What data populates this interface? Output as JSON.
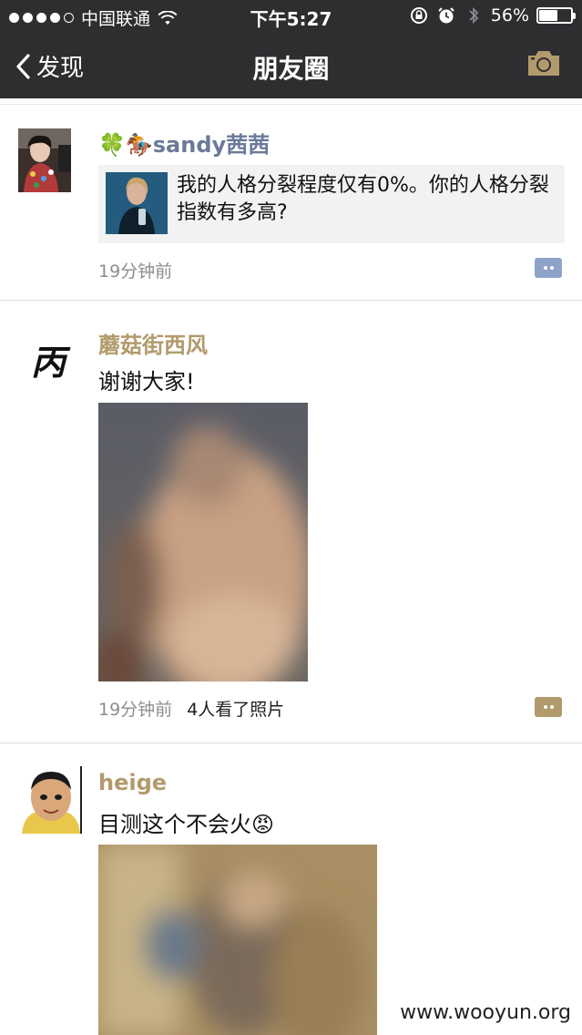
{
  "status_bar": {
    "carrier": "中国联通",
    "time": "下午5:27",
    "battery": "56%",
    "battery_level": 0.56,
    "icons": [
      "signal-dots",
      "wifi-icon",
      "rotation-lock-icon",
      "alarm-icon",
      "bluetooth-icon",
      "battery-icon"
    ]
  },
  "nav": {
    "back_label": "发现",
    "title": "朋友圈",
    "icons": [
      "chevron-left-icon",
      "camera-icon"
    ]
  },
  "posts": [
    {
      "name": "🍀🏇sandy茜茜",
      "share_text": "我的人格分裂程度仅有0%。你的人格分裂指数有多高?",
      "time": "19分钟前"
    },
    {
      "name": "蘑菇街西风",
      "avatar_char": "丙",
      "text": "谢谢大家!",
      "time": "19分钟前",
      "seen": "4人看了照片"
    },
    {
      "name": "heige",
      "text": "目测这个不会火😡",
      "time": ""
    }
  ],
  "colors": {
    "nav_bg": "#2e2e31",
    "link_blue": "#6b7a99",
    "link_gold": "#b19a6c",
    "comment_blue": "#8fa3c8",
    "comment_gold": "#b19a6c"
  },
  "watermark": "www.wooyun.org"
}
